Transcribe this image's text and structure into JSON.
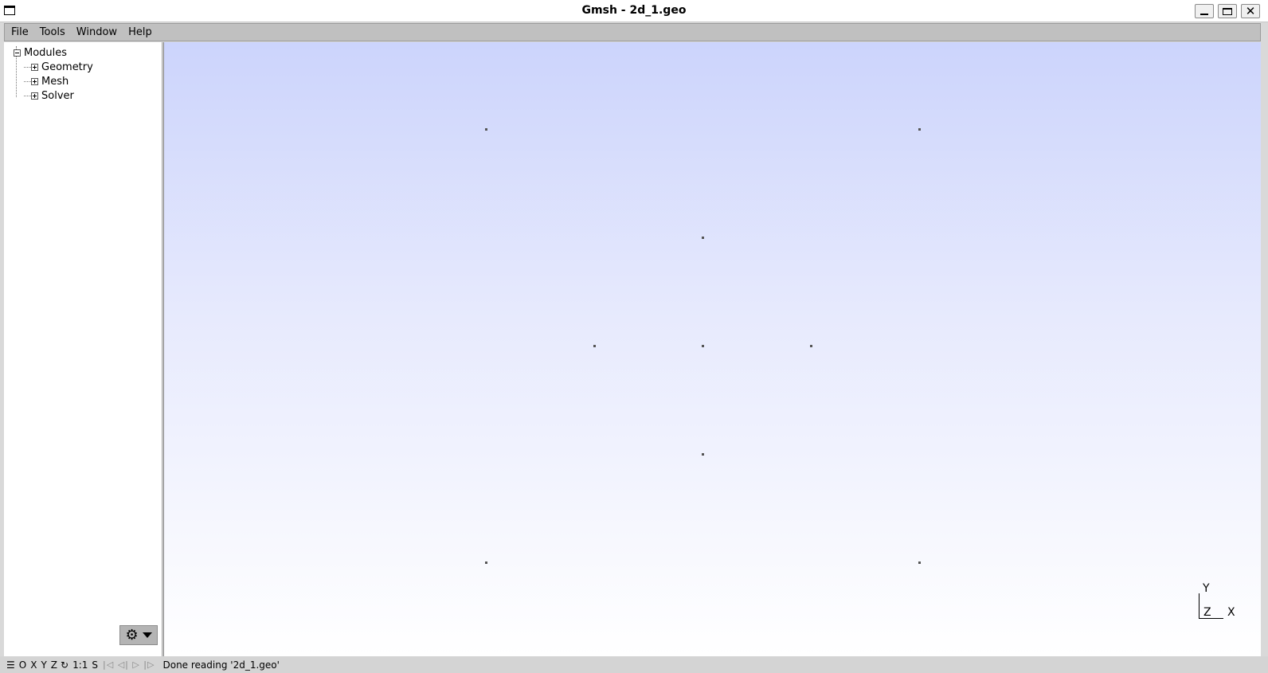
{
  "window": {
    "title": "Gmsh - 2d_1.geo"
  },
  "menu": [
    "File",
    "Tools",
    "Window",
    "Help"
  ],
  "tree": {
    "root": "Modules",
    "children": [
      "Geometry",
      "Mesh",
      "Solver"
    ]
  },
  "axes": {
    "y": "Y",
    "z": "Z",
    "x": "X"
  },
  "statusbar": {
    "buttons": [
      "O",
      "X",
      "Y",
      "Z",
      "1:1",
      "S"
    ],
    "message": "Done reading '2d_1.geo'"
  },
  "icons": {
    "menu": "hamburger-icon",
    "rotate": "rotate-icon",
    "gear": "gear-icon",
    "nav": "playback-nav-icons"
  }
}
